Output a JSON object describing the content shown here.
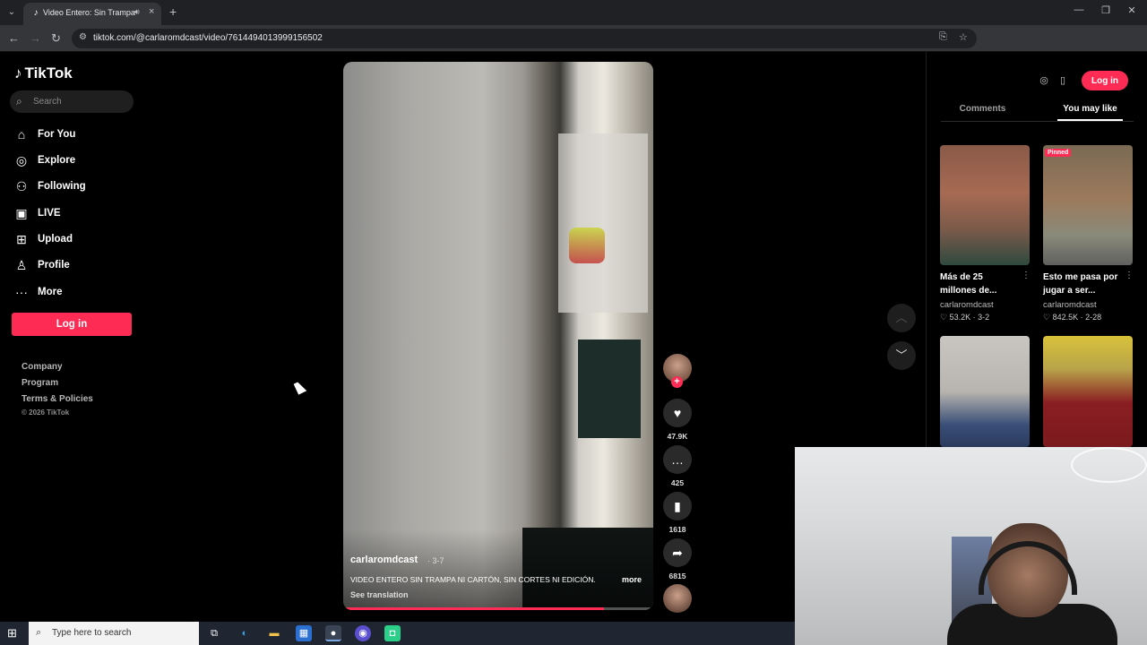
{
  "browser": {
    "tab_title": "Video Entero: Sin Trampa ni Cartón",
    "url": "tiktok.com/@carlaromdcast/video/7614494013999156502",
    "new_tab": "+",
    "controls": {
      "minimize": "—",
      "restore": "❐",
      "close": "✕"
    }
  },
  "sidebar": {
    "logo": "TikTok",
    "search_placeholder": "Search",
    "items": [
      {
        "label": "For You",
        "icon": "home-icon",
        "glyph": "⌂"
      },
      {
        "label": "Explore",
        "icon": "compass-icon",
        "glyph": "◎"
      },
      {
        "label": "Following",
        "icon": "following-icon",
        "glyph": "⚇"
      },
      {
        "label": "LIVE",
        "icon": "live-icon",
        "glyph": "▣"
      },
      {
        "label": "Upload",
        "icon": "upload-icon",
        "glyph": "⊞"
      },
      {
        "label": "Profile",
        "icon": "profile-icon",
        "glyph": "♙"
      },
      {
        "label": "More",
        "icon": "more-icon",
        "glyph": "···"
      }
    ],
    "login": "Log in",
    "footer": [
      "Company",
      "Program",
      "Terms & Policies"
    ],
    "copyright": "© 2026 TikTok"
  },
  "video": {
    "author": "carlaromdcast",
    "date": "· 3-7",
    "caption": "VIDEO ENTERO SIN TRAMPA NI CARTÓN, SIN CORTES NI EDICIÓN.",
    "more": "more",
    "translate": "See translation",
    "progress": 0.84
  },
  "actions": {
    "follow": "+",
    "likes": "47.9K",
    "comments": "425",
    "saves": "1618",
    "shares": "6815"
  },
  "right_panel": {
    "tabs": {
      "comments": "Comments",
      "you_may_like": "You may like"
    },
    "login": "Log in",
    "pinned": "Pinned",
    "recommended": [
      {
        "title": "Más de 25 millones de...",
        "author": "carlaromdcast",
        "likes": "53.2K",
        "date": "3-2"
      },
      {
        "title": "Esto me pasa por jugar a ser...",
        "author": "carlaromdcast",
        "likes": "842.5K",
        "date": "2-28"
      }
    ]
  },
  "taskbar": {
    "search_placeholder": "Type here to search"
  },
  "colors": {
    "accent": "#fe2c55",
    "background": "#000000"
  }
}
